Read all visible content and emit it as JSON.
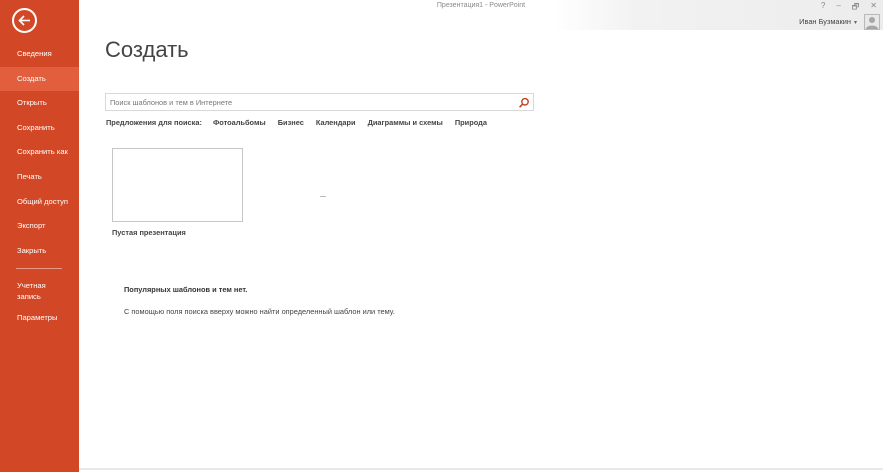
{
  "window": {
    "title": "Презентация1 - PowerPoint",
    "controls": {
      "help": "?",
      "minimize": "–",
      "restore": "🗗",
      "close": "✕"
    }
  },
  "user": {
    "name": "Иван Бузмакин",
    "caret": "▾"
  },
  "sidebar": {
    "items": [
      {
        "label": "Сведения"
      },
      {
        "label": "Создать",
        "active": true
      },
      {
        "label": "Открыть"
      },
      {
        "label": "Сохранить"
      },
      {
        "label": "Сохранить как"
      },
      {
        "label": "Печать"
      },
      {
        "label": "Общий доступ"
      },
      {
        "label": "Экспорт"
      },
      {
        "label": "Закрыть"
      }
    ],
    "bottom_items": [
      {
        "label": "Учетная запись"
      },
      {
        "label": "Параметры"
      }
    ]
  },
  "main": {
    "title": "Создать",
    "search": {
      "placeholder": "Поиск шаблонов и тем в Интернете",
      "value": ""
    },
    "suggestions": {
      "label": "Предложения для поиска:",
      "links": [
        "Фотоальбомы",
        "Бизнес",
        "Календари",
        "Диаграммы и схемы",
        "Природа"
      ]
    },
    "templates": [
      {
        "label": "Пустая презентация"
      }
    ],
    "popular_empty": "Популярных шаблонов и тем нет.",
    "hint": "С помощью поля поиска вверху можно найти определенный шаблон или тему."
  },
  "colors": {
    "accent": "#d24726",
    "accent_active": "#e35e3d"
  },
  "icons": {
    "back": "back-arrow-icon",
    "search": "magnifier-icon",
    "avatar": "user-avatar-icon"
  }
}
